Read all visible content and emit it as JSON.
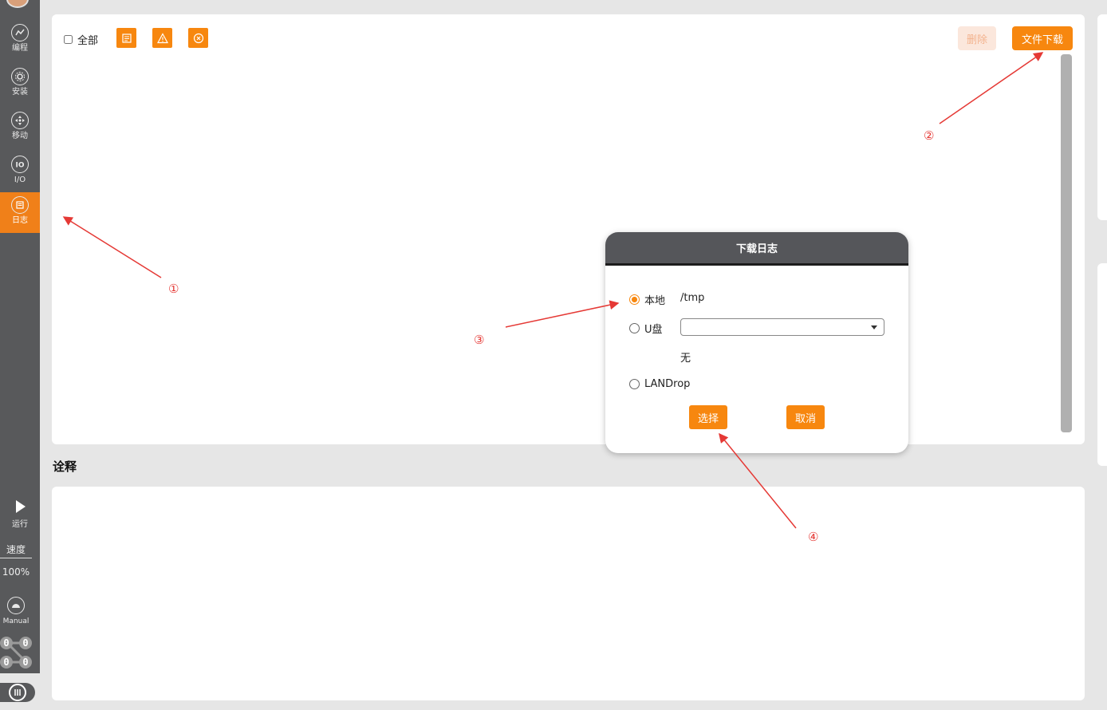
{
  "sidebar": {
    "items": [
      {
        "label": "编程",
        "icon": "program-icon"
      },
      {
        "label": "安装",
        "icon": "install-icon"
      },
      {
        "label": "移动",
        "icon": "move-icon"
      },
      {
        "label": "I/O",
        "icon": "io-icon"
      },
      {
        "label": "日志",
        "icon": "log-icon",
        "active": true
      }
    ],
    "run_label": "运行",
    "speed_label": "速度",
    "speed_value": "100%",
    "manual_label": "Manual",
    "io_values": [
      "0",
      "0",
      "0",
      "0"
    ]
  },
  "toolbar": {
    "all_label": "全部",
    "delete_label": "删除",
    "download_label": "文件下载"
  },
  "notes_title": "诠释",
  "dialog": {
    "title": "下载日志",
    "local_label": "本地",
    "local_path": "/tmp",
    "usb_label": "U盘",
    "usb_selected": "",
    "usb_none": "无",
    "landrop_label": "LANDrop",
    "select_label": "选择",
    "cancel_label": "取消"
  },
  "annotations": [
    "①",
    "②",
    "③",
    "④"
  ],
  "colors": {
    "accent": "#f7870f",
    "sidebar": "#58595b",
    "annotation": "#e53935"
  }
}
